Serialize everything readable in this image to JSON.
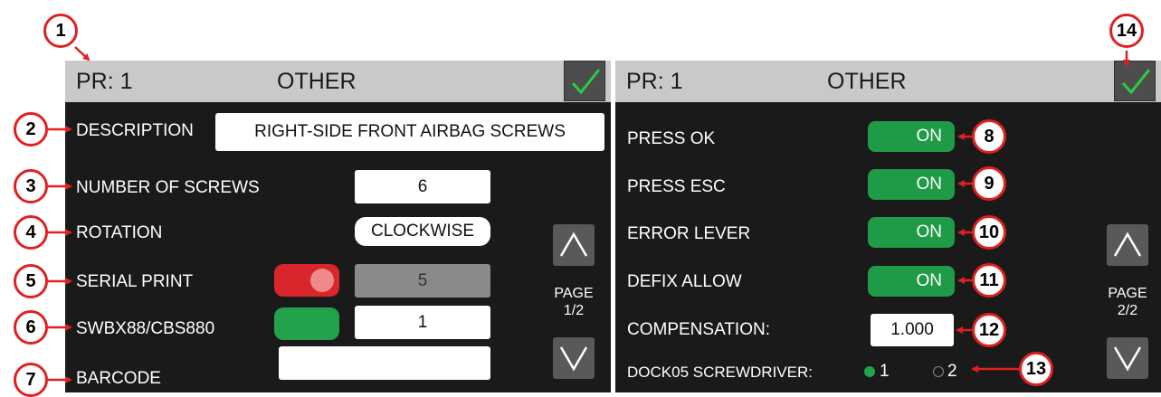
{
  "left_panel": {
    "header": {
      "pr": "PR: 1",
      "title": "OTHER"
    },
    "description": {
      "label": "DESCRIPTION",
      "value": "RIGHT-SIDE FRONT AIRBAG  SCREWS"
    },
    "screws": {
      "label": "NUMBER OF SCREWS",
      "value": "6"
    },
    "rotation": {
      "label": "ROTATION",
      "value": "CLOCKWISE"
    },
    "serial_print": {
      "label": "SERIAL PRINT",
      "value": "5"
    },
    "swbx": {
      "label": "SWBX88/CBS880",
      "value": "1"
    },
    "barcode": {
      "label": "BARCODE",
      "value": ""
    },
    "page": {
      "label": "PAGE",
      "number": "1/2"
    }
  },
  "right_panel": {
    "header": {
      "pr": "PR: 1",
      "title": "OTHER"
    },
    "press_ok": {
      "label": "PRESS OK",
      "toggle": "ON"
    },
    "press_esc": {
      "label": "PRESS ESC",
      "toggle": "ON"
    },
    "error_lever": {
      "label": "ERROR LEVER",
      "toggle": "ON"
    },
    "defix_allow": {
      "label": "DEFIX ALLOW",
      "toggle": "ON"
    },
    "compensation": {
      "label": "COMPENSATION:",
      "value": "1.000"
    },
    "dock": {
      "label": "DOCK05 SCREWDRIVER:",
      "option1": "1",
      "option2": "2"
    },
    "page": {
      "label": "PAGE",
      "number": "2/2"
    }
  },
  "callouts": [
    "1",
    "2",
    "3",
    "4",
    "5",
    "6",
    "7",
    "8",
    "9",
    "10",
    "11",
    "12",
    "13",
    "14"
  ],
  "colors": {
    "accent_green": "#22a24a",
    "toggle_red": "#d9262c",
    "callout_red": "#e02020",
    "check_green": "#2ecc40"
  }
}
